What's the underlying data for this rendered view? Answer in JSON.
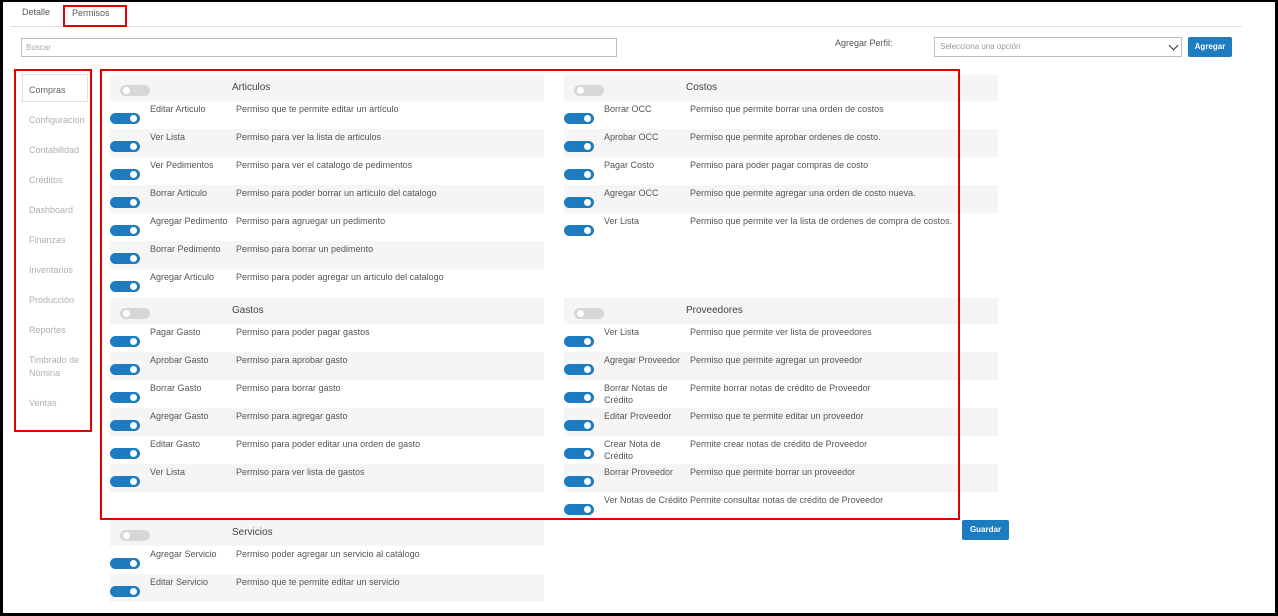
{
  "tabs": [
    {
      "label": "Detalle"
    },
    {
      "label": "Permisos"
    }
  ],
  "search": {
    "placeholder": "Buscar"
  },
  "profile": {
    "label": "Agregar Perfil:",
    "select_value": "Selecciona una opción",
    "add_label": "Agregar"
  },
  "save_label": "Guardar",
  "nav": [
    {
      "label": "Compras",
      "active": true
    },
    {
      "label": "Configuracion"
    },
    {
      "label": "Contabilidad"
    },
    {
      "label": "Créditos"
    },
    {
      "label": "Dashboard"
    },
    {
      "label": "Finanzas"
    },
    {
      "label": "Inventarios"
    },
    {
      "label": "Producción"
    },
    {
      "label": "Reportes"
    },
    {
      "label": "Timbrado de Nómina"
    },
    {
      "label": "Ventas"
    }
  ],
  "sections": [
    {
      "title": "Articulos",
      "enabled": false,
      "rows": [
        {
          "name": "Editar Articulo",
          "desc": "Permiso que te permite editar un artículo",
          "on": true
        },
        {
          "name": "Ver Lista",
          "desc": "Permiso para ver la lista de articulos",
          "on": true
        },
        {
          "name": "Ver Pedimentos",
          "desc": "Permiso para ver el catalogo de pedimentos",
          "on": true
        },
        {
          "name": "Borrar Articulo",
          "desc": "Permiso para poder borrar un articulo del catalogo",
          "on": true
        },
        {
          "name": "Agregar Pedimento",
          "desc": "Permiso para agruegar un pedimento",
          "on": true
        },
        {
          "name": "Borrar Pedimento",
          "desc": "Permiso para borrar un pedimento",
          "on": true
        },
        {
          "name": "Agregar Articulo",
          "desc": "Permiso para poder agregar un articulo del catalogo",
          "on": true
        }
      ]
    },
    {
      "title": "Costos",
      "enabled": false,
      "rows": [
        {
          "name": "Borrar OCC",
          "desc": "Permiso que permite borrar una orden de costos",
          "on": true
        },
        {
          "name": "Aprobar OCC",
          "desc": "Permiso que permite aprobar ordenes de costo.",
          "on": true
        },
        {
          "name": "Pagar Costo",
          "desc": "Permiso para poder pagar compras de costo",
          "on": true
        },
        {
          "name": "Agregar OCC",
          "desc": "Permiso que permite agregar una orden de costo nueva.",
          "on": true
        },
        {
          "name": "Ver Lista",
          "desc": "Permiso que permite ver la lista de ordenes de compra de costos.",
          "on": true
        }
      ]
    },
    {
      "title": "Gastos",
      "enabled": false,
      "rows": [
        {
          "name": "Pagar Gasto",
          "desc": "Permiso para poder pagar gastos",
          "on": true
        },
        {
          "name": "Aprobar Gasto",
          "desc": "Permiso para aprobar gasto",
          "on": true
        },
        {
          "name": "Borrar Gasto",
          "desc": "Permiso para borrar gasto",
          "on": true
        },
        {
          "name": "Agregar Gasto",
          "desc": "Permiso para agregar gasto",
          "on": true
        },
        {
          "name": "Editar Gasto",
          "desc": "Permiso para poder editar una orden de gasto",
          "on": true
        },
        {
          "name": "Ver Lista",
          "desc": "Permiso para ver lista de gastos",
          "on": true
        }
      ]
    },
    {
      "title": "Proveedores",
      "enabled": false,
      "rows": [
        {
          "name": "Ver Lista",
          "desc": "Permiso que permite ver lista de proveedores",
          "on": true
        },
        {
          "name": "Agregar Proveedor",
          "desc": "Permiso que permite agregar un proveedor",
          "on": true
        },
        {
          "name": "Borrar Notas de Crédito",
          "desc": "Permite borrar notas de crédito de Proveedor",
          "on": true
        },
        {
          "name": "Editar Proveedor",
          "desc": "Permiso que te permite editar un proveedor",
          "on": true
        },
        {
          "name": "Crear Nota de Crédito",
          "desc": "Permite crear notas de crédito de Proveedor",
          "on": true
        },
        {
          "name": "Borrar Proveedor",
          "desc": "Permiso que permite borrar un proveedor",
          "on": true
        },
        {
          "name": "Ver Notas de Crédito",
          "desc": "Permite consultar notas de crédito de Proveedor",
          "on": true
        }
      ]
    },
    {
      "title": "Servicios",
      "enabled": false,
      "rows": [
        {
          "name": "Agregar Servicio",
          "desc": "Permiso poder agregar un servicio al catálogo",
          "on": true
        },
        {
          "name": "Editar Servicio",
          "desc": "Permiso que te permite editar un servicio",
          "on": true
        }
      ]
    }
  ],
  "colors": {
    "accent": "#1d7bc0",
    "highlight": "#e00000",
    "toggle_off": "#d7d7d7"
  }
}
